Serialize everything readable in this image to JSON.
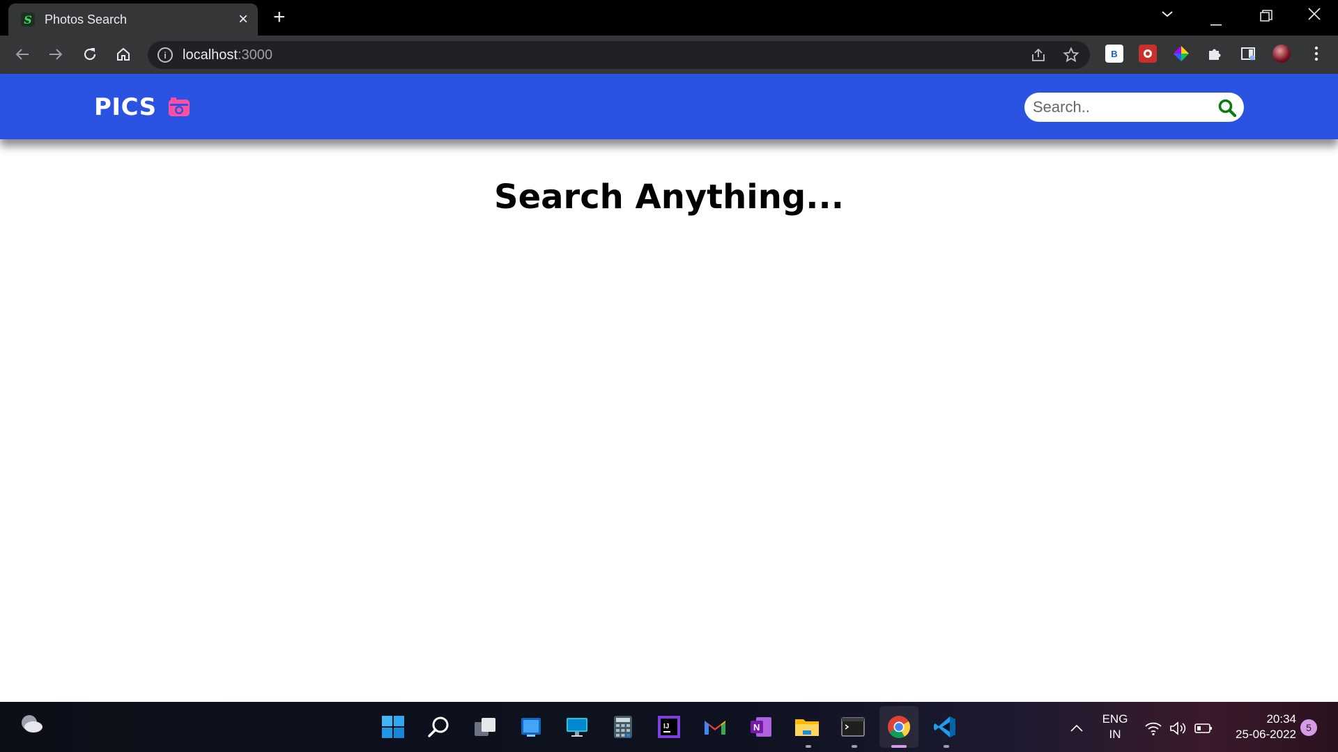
{
  "browser": {
    "tab": {
      "title": "Photos Search",
      "favicon": "S"
    },
    "address": {
      "host": "localhost",
      "port": ":3000"
    },
    "extensions": [
      "bitwarden-icon",
      "ublock-icon",
      "color-picker-icon",
      "extensions-puzzle-icon",
      "sidebar-icon",
      "profile-avatar"
    ]
  },
  "page": {
    "brand": {
      "name": "PICS",
      "icon": "camera-retro-icon",
      "icon_color": "#ff4fa3"
    },
    "navbar_color": "#2a53e2",
    "search": {
      "placeholder": "Search..",
      "button_icon": "search-icon",
      "button_color": "#0a7a0a"
    },
    "heading": "Search Anything..."
  },
  "taskbar": {
    "apps": [
      "start",
      "search",
      "task-view",
      "widgets",
      "remote-desktop",
      "calculator",
      "intellij",
      "gmail",
      "onenote",
      "file-explorer",
      "terminal",
      "chrome",
      "vscode"
    ],
    "tray": {
      "language": "ENG",
      "region": "IN",
      "time": "20:34",
      "date": "25-06-2022",
      "notifications": "5"
    }
  }
}
